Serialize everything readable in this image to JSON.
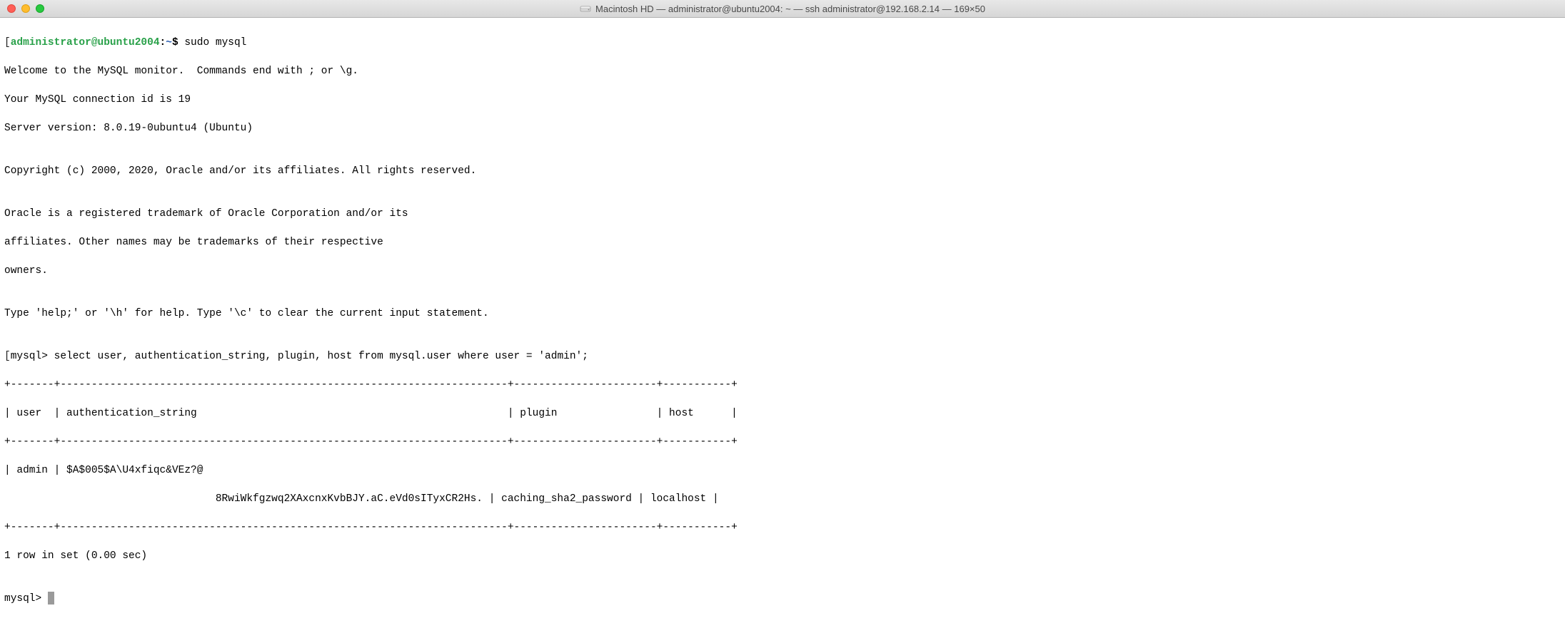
{
  "titlebar": {
    "title": "Macintosh HD — administrator@ubuntu2004: ~ — ssh administrator@192.168.2.14 — 169×50"
  },
  "prompt": {
    "bracket_open": "[",
    "userhost": "administrator@ubuntu2004",
    "colon": ":",
    "path": "~",
    "dollar": "$",
    "command": "sudo mysql"
  },
  "banner": {
    "l1": "Welcome to the MySQL monitor.  Commands end with ; or \\g.",
    "l2": "Your MySQL connection id is 19",
    "l3": "Server version: 8.0.19-0ubuntu4 (Ubuntu)",
    "l4": "",
    "l5": "Copyright (c) 2000, 2020, Oracle and/or its affiliates. All rights reserved.",
    "l6": "",
    "l7": "Oracle is a registered trademark of Oracle Corporation and/or its",
    "l8": "affiliates. Other names may be trademarks of their respective",
    "l9": "owners.",
    "l10": "",
    "l11": "Type 'help;' or '\\h' for help. Type '\\c' to clear the current input statement.",
    "l12": ""
  },
  "mysql": {
    "prompt_bracket": "[",
    "prompt1": "mysql> ",
    "query": "select user, authentication_string, plugin, host from mysql.user where user = 'admin';",
    "tbl_border_top": "+-------+------------------------------------------------------------------------+-----------------------+-----------+",
    "tbl_header": "| user  | authentication_string                                                  | plugin                | host      |",
    "tbl_border_mid": "+-------+------------------------------------------------------------------------+-----------------------+-----------+",
    "tbl_row_l1": "| admin | $A$005$A\\U4xfiqc&VEz?@",
    "tbl_row_l2": "                                  8RwiWkfgzwq2XAxcnxKvbBJY.aC.eVd0sITyxCR2Hs. | caching_sha2_password | localhost |",
    "tbl_border_bot": "+-------+------------------------------------------------------------------------+-----------------------+-----------+",
    "result": "1 row in set (0.00 sec)",
    "blank": "",
    "prompt2": "mysql> "
  }
}
